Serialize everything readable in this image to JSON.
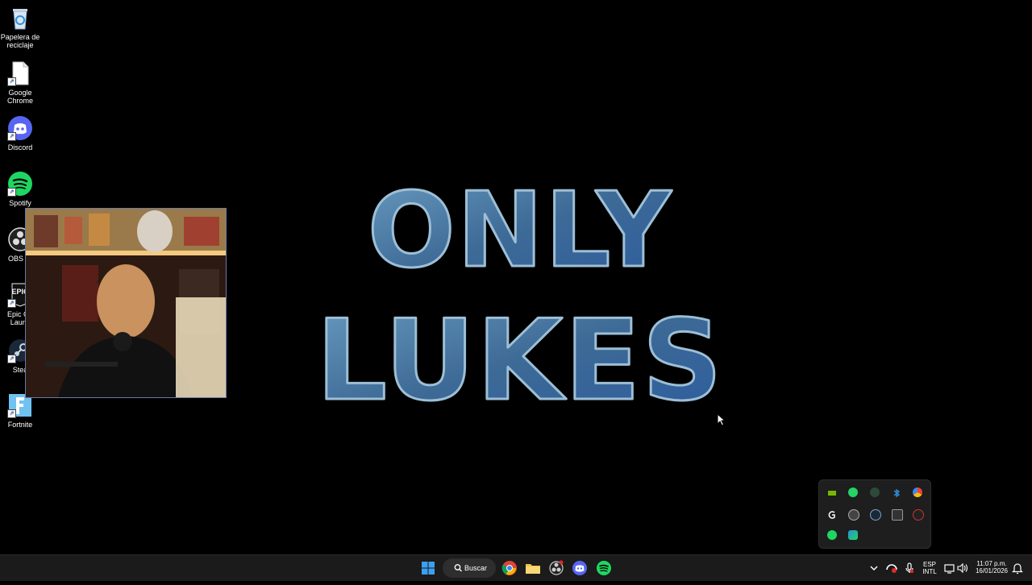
{
  "desktop": {
    "icons": [
      {
        "label": "Papelera de reciclaje",
        "icon": "recycle-bin-icon"
      },
      {
        "label": "Google Chrome",
        "icon": "chrome-file-icon"
      },
      {
        "label": "Discord",
        "icon": "discord-icon"
      },
      {
        "label": "Spotify",
        "icon": "spotify-icon"
      },
      {
        "label": "OBS St",
        "icon": "obs-icon"
      },
      {
        "label": "Epic Ga Launc",
        "icon": "epic-games-icon"
      },
      {
        "label": "Stea",
        "icon": "steam-icon"
      },
      {
        "label": "Fortnite",
        "icon": "fortnite-icon"
      }
    ]
  },
  "wallpaper": {
    "line1": "ONLY",
    "line2": "LUKES"
  },
  "taskbar": {
    "search_label": "Buscar",
    "language_line1": "ESP",
    "language_line2": "INTL",
    "time": "11:07 p.m.",
    "date": "16/01/2026"
  },
  "colors": {
    "accent_blue": "#2f8fdc",
    "spotify_green": "#1ed760",
    "discord_blurple": "#5865f2",
    "taskbar_bg": "#1b1b1b"
  }
}
